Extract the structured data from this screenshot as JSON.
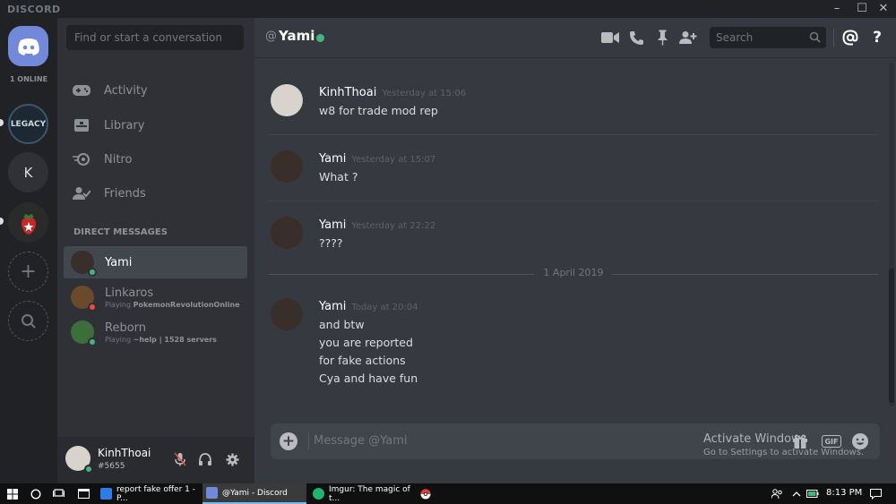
{
  "window": {
    "brand": "DISCORD",
    "controls": [
      "–",
      "☐",
      "✕"
    ]
  },
  "rail": {
    "online_count": "1 ONLINE",
    "servers": [
      {
        "name": "LEGACY",
        "short": "LEGACY"
      },
      {
        "name": "K",
        "short": "K"
      },
      {
        "name": "strawberry-server",
        "short": ""
      }
    ],
    "add_server": "+"
  },
  "sidebar": {
    "search_placeholder": "Find or start a conversation",
    "nav": [
      {
        "label": "Activity",
        "icon": "controller-icon"
      },
      {
        "label": "Library",
        "icon": "library-icon"
      },
      {
        "label": "Nitro",
        "icon": "nitro-icon"
      },
      {
        "label": "Friends",
        "icon": "friends-icon"
      }
    ],
    "dm_header": "DIRECT MESSAGES",
    "dms": [
      {
        "name": "Yami",
        "sub_prefix": "",
        "sub_game": "",
        "status": "#43b581",
        "avatar": "#3a2e2a"
      },
      {
        "name": "Linkaros",
        "sub_prefix": "Playing ",
        "sub_game": "PokemonRevolutionOnline",
        "status": "#f04747",
        "avatar": "#6b4a2b"
      },
      {
        "name": "Reborn",
        "sub_prefix": "Playing ",
        "sub_game": "~help | 1528 servers",
        "status": "#43b581",
        "avatar": "#3b6e3b"
      }
    ],
    "user": {
      "name": "KinhThoai",
      "tag": "#5655"
    }
  },
  "chat": {
    "header": {
      "at": "@",
      "name": "Yami",
      "search_placeholder": "Search"
    },
    "messages": [
      {
        "author": "KinhThoai",
        "time": "Yesterday at 15:06",
        "lines": [
          "w8 for trade mod rep"
        ],
        "avatar": "#d8d3cc"
      },
      {
        "author": "Yami",
        "time": "Yesterday at 15:07",
        "lines": [
          "What ?"
        ],
        "avatar": "#3a2e2a"
      },
      {
        "author": "Yami",
        "time": "Yesterday at 22:22",
        "lines": [
          "????"
        ],
        "avatar": "#3a2e2a"
      },
      {
        "author": "Yami",
        "time": "Today at 20:04",
        "lines": [
          "and btw",
          "you are reported",
          "for fake actions",
          "Cya and have fun"
        ],
        "avatar": "#3a2e2a"
      }
    ],
    "date_separator": "1 April 2019",
    "composer": {
      "placeholder": "Message @Yami",
      "watermark_line1": "Activate Windows",
      "watermark_line2": "Go to Settings to activate Windows.",
      "gif_label": "GIF"
    }
  },
  "taskbar": {
    "tasks": [
      {
        "label": "report fake offer 1 - P...",
        "color": "#2b7de9"
      },
      {
        "label": "@Yami - Discord",
        "color": "#7289da"
      },
      {
        "label": "Imgur: The magic of t...",
        "color": "#1bb76e"
      }
    ],
    "clock": "8:13 PM"
  },
  "colors": {
    "accent": "#7289da",
    "online": "#43b581",
    "dnd": "#f04747"
  }
}
